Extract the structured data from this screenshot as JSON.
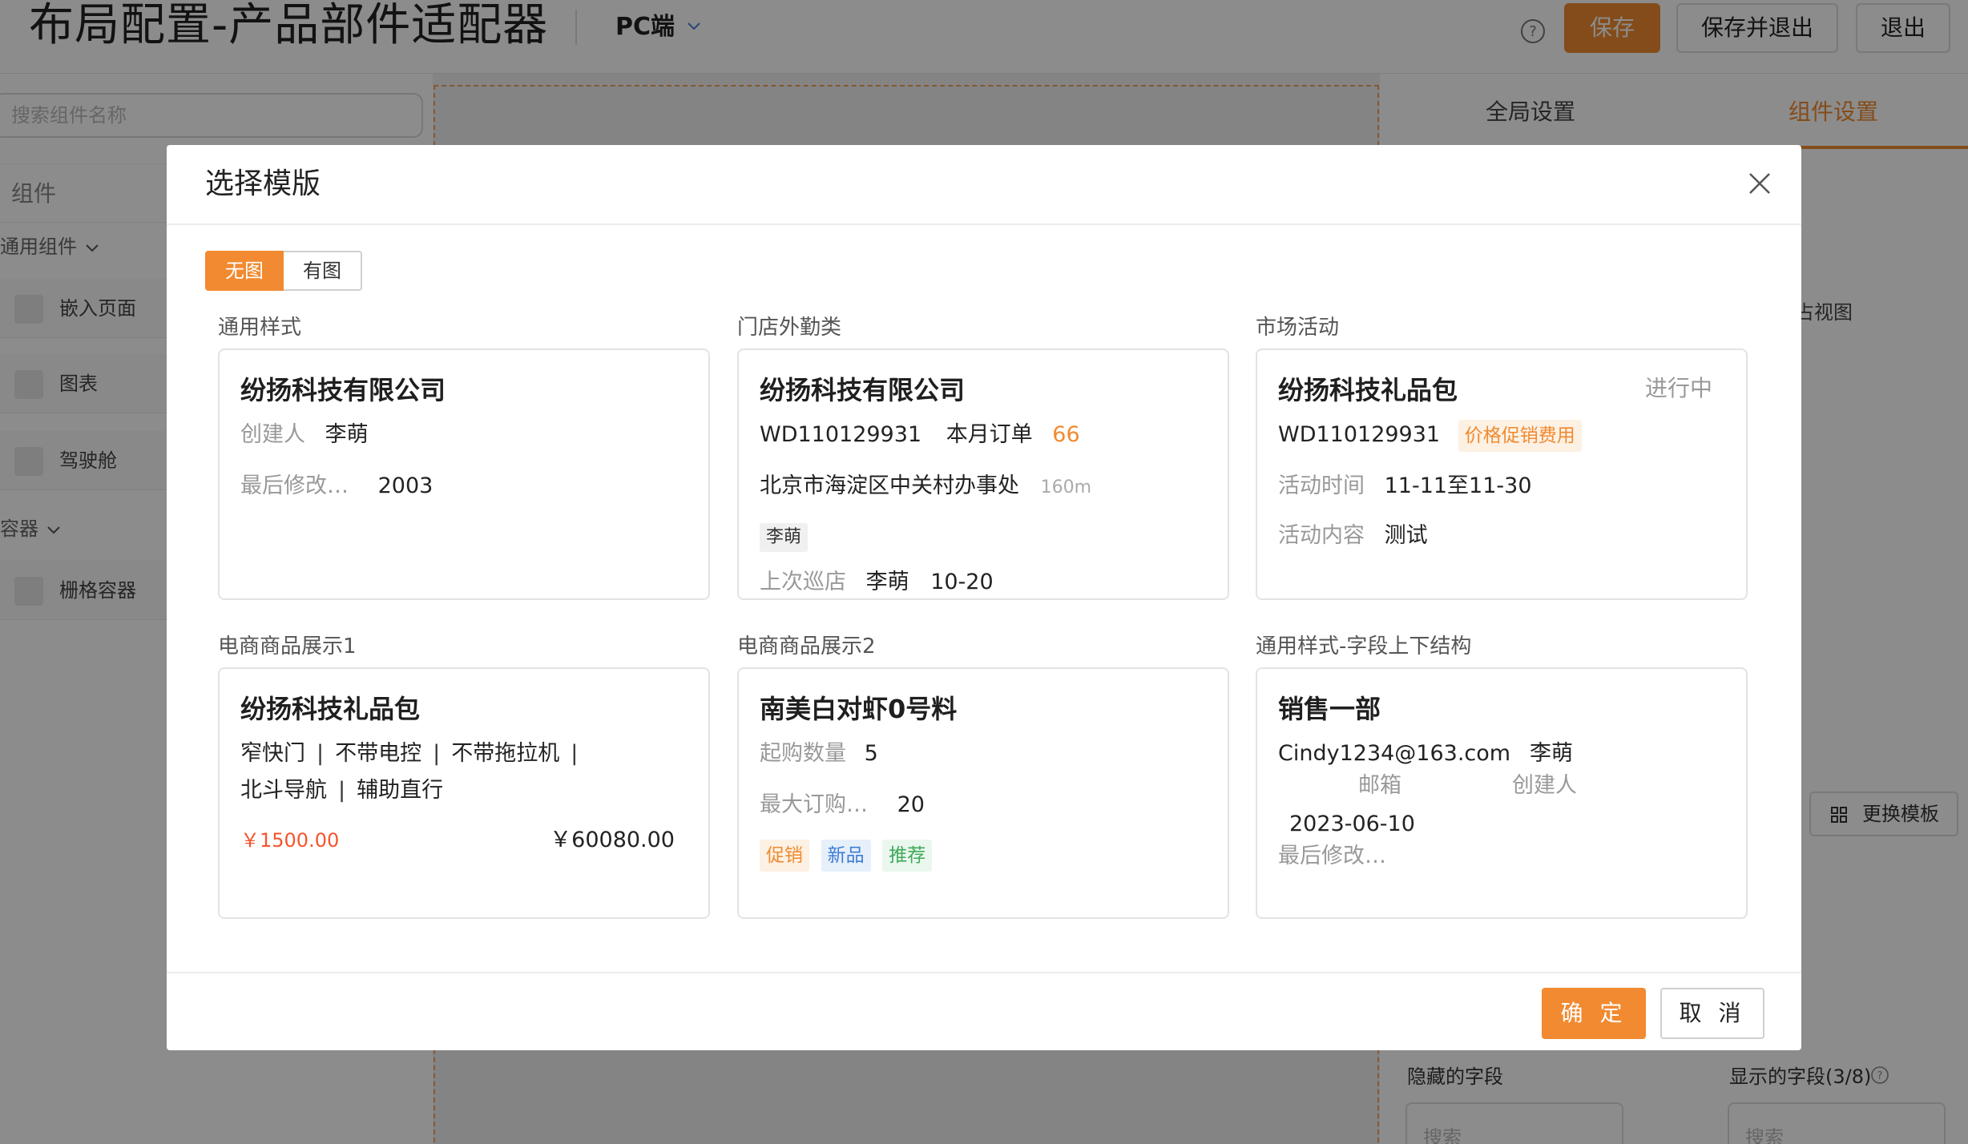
{
  "app": {
    "title": "布局配置-产品部件适配器",
    "platform": "PC端",
    "save_label": "保存",
    "save_exit_label": "保存并退出",
    "exit_label": "退出"
  },
  "left_panel": {
    "search_placeholder": "搜索组件名称",
    "header": "组件",
    "groups": [
      {
        "label": "通用组件",
        "items": [
          "嵌入页面",
          "图表",
          "驾驶舱"
        ]
      },
      {
        "label": "容器",
        "items": [
          "栅格容器"
        ]
      }
    ]
  },
  "right_panel": {
    "tabs": [
      "全局设置",
      "组件设置"
    ],
    "active_tab": "组件设置",
    "view_label": "占视图",
    "change_template_label": "更换模板",
    "hidden_fields_label": "隐藏的字段",
    "shown_fields_label": "显示的字段(3/8)",
    "search_placeholder": "搜索"
  },
  "modal": {
    "title": "选择模版",
    "segments": [
      "无图",
      "有图"
    ],
    "active_segment": "无图",
    "ok_label": "确 定",
    "cancel_label": "取 消",
    "templates": {
      "general": {
        "label": "通用样式",
        "title": "纷扬科技有限公司",
        "creator_key": "创建人",
        "creator": "李萌",
        "modified_key": "最后修改…",
        "modified": "2003"
      },
      "store": {
        "label": "门店外勤类",
        "title": "纷扬科技有限公司",
        "code": "WD110129931",
        "orders_key": "本月订单",
        "orders": "66",
        "address": "北京市海淀区中关村办事处",
        "distance": "160m",
        "person_tag": "李萌",
        "last_visit_key": "上次巡店",
        "last_visit_person": "李萌",
        "last_visit_date": "10-20"
      },
      "market": {
        "label": "市场活动",
        "title": "纷扬科技礼品包",
        "status": "进行中",
        "code": "WD110129931",
        "tag": "价格促销费用",
        "time_key": "活动时间",
        "time": "11-11至11-30",
        "content_key": "活动内容",
        "content": "测试"
      },
      "ecom1": {
        "label": "电商商品展示1",
        "title": "纷扬科技礼品包",
        "features": [
          "窄快门",
          "不带电控",
          "不带拖拉机",
          "北斗导航",
          "辅助直行"
        ],
        "price": "￥1500.00",
        "total": "￥60080.00"
      },
      "ecom2": {
        "label": "电商商品展示2",
        "title": "南美白对虾0号料",
        "min_key": "起购数量",
        "min": "5",
        "max_key": "最大订购…",
        "max": "20",
        "tags": [
          "促销",
          "新品",
          "推荐"
        ]
      },
      "vertical": {
        "label": "通用样式-字段上下结构",
        "title": "销售一部",
        "email": "Cindy1234@163.com",
        "email_key": "邮箱",
        "creator": "李萌",
        "creator_key": "创建人",
        "date": "2023-06-10",
        "date_key": "最后修改…"
      }
    }
  },
  "colors": {
    "accent": "#f18a30",
    "price_red": "#f5542e",
    "tag_blue": "#3f7cd3",
    "tag_green": "#3fa95a"
  }
}
